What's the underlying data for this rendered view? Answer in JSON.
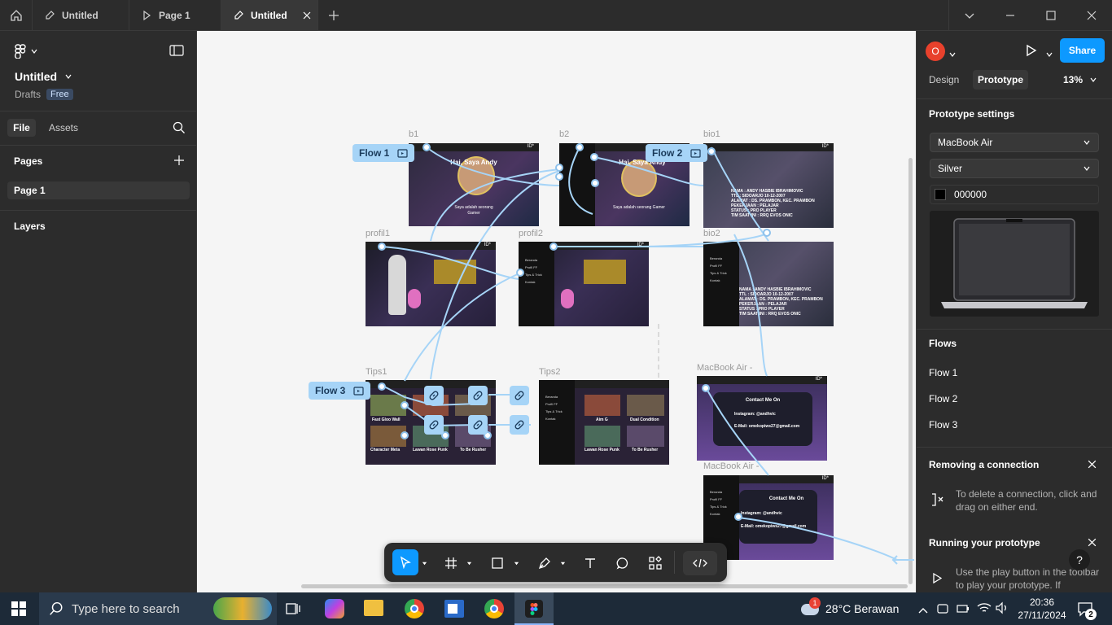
{
  "tabs": [
    {
      "label": "Untitled"
    },
    {
      "label": "Page 1"
    },
    {
      "label": "Untitled"
    }
  ],
  "left": {
    "file_name": "Untitled",
    "drafts": "Drafts",
    "plan_badge": "Free",
    "tab_file": "File",
    "tab_assets": "Assets",
    "pages_title": "Pages",
    "page_item": "Page 1",
    "layers_title": "Layers"
  },
  "canvas": {
    "frames": [
      {
        "label": "b1"
      },
      {
        "label": "b2"
      },
      {
        "label": "bio1"
      },
      {
        "label": "profil1"
      },
      {
        "label": "profil2"
      },
      {
        "label": "bio2"
      },
      {
        "label": "Tips1"
      },
      {
        "label": "Tips2"
      },
      {
        "label": "MacBook Air -"
      },
      {
        "label": "MacBook Air -"
      }
    ],
    "flows": [
      "Flow 1",
      "Flow 2",
      "Flow 3"
    ],
    "frame_text": {
      "hai": "Hai, Saya Andy",
      "gamer": "Saya adalah seorang Gamer",
      "id": "ID*",
      "bio_lines": [
        "NAMA : ANDY HASBIE IBRAHIMOVIC",
        "TTL : SIDOARJO 10-12-2007",
        "ALAMAT : DS. PRAMBON, KEC. PRAMBON",
        "PEKERJAAN : PELAJAR",
        "STATUS : PRO PLAYER",
        "TIM SAAT INI : RRQ EVOS ONIC"
      ],
      "menu": [
        "Beranda",
        "Profil FF",
        "Tips & Trick",
        "Kontak"
      ],
      "tips": [
        "Fast Gloo Wall",
        "Dual Condition",
        "Character Meta",
        "Lawan Rose Punk",
        "To Be Rusher",
        "Aim G"
      ],
      "contact_title": "Contact Me On",
      "instagram": "Instagram: @andhvic",
      "email": "E-Mail: omekopiws27@gmail.com"
    }
  },
  "right": {
    "avatar": "O",
    "share": "Share",
    "tab_design": "Design",
    "tab_prototype": "Prototype",
    "zoom": "13%",
    "proto_settings": "Prototype settings",
    "device": "MacBook Air",
    "color_model": "Silver",
    "bg_hex": "000000",
    "flows_title": "Flows",
    "flows": [
      "Flow 1",
      "Flow 2",
      "Flow 3"
    ],
    "remove_title": "Removing a connection",
    "remove_text": "To delete a connection, click and drag on either end.",
    "running_title": "Running your prototype",
    "running_text": "Use the play button in the toolbar to play your prototype. If"
  },
  "taskbar": {
    "search_placeholder": "Type here to search",
    "weather": "28°C  Berawan",
    "time": "20:36",
    "date": "27/11/2024",
    "notif_count": "2",
    "weather_badge": "1"
  },
  "colors": {
    "accent": "#0d99ff",
    "flow": "#a6d4f7",
    "canvas": "#f5f5f5",
    "panel": "#2c2c2c"
  }
}
